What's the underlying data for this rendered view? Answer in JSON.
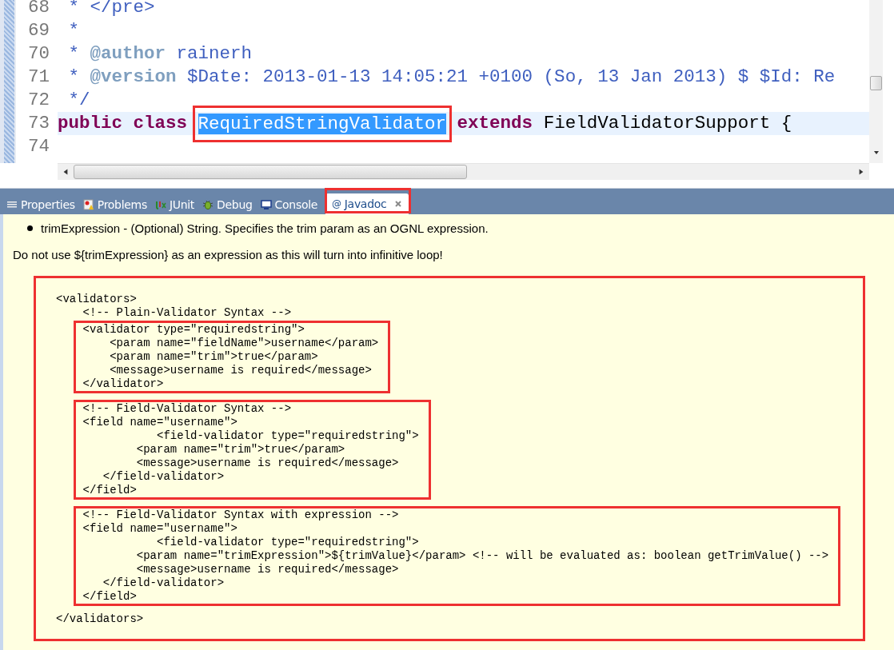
{
  "editor": {
    "lines": [
      {
        "number": "68",
        "current": false,
        "segments": [
          {
            "kind": "doc",
            "text": " * </pre>"
          }
        ]
      },
      {
        "number": "69",
        "current": false,
        "segments": [
          {
            "kind": "doc",
            "text": " *"
          }
        ]
      },
      {
        "number": "70",
        "current": false,
        "segments": [
          {
            "kind": "doc",
            "text": " * "
          },
          {
            "kind": "doctag",
            "text": "@author"
          },
          {
            "kind": "doc",
            "text": " rainerh"
          }
        ]
      },
      {
        "number": "71",
        "current": false,
        "segments": [
          {
            "kind": "doc",
            "text": " * "
          },
          {
            "kind": "doctag",
            "text": "@version"
          },
          {
            "kind": "doc",
            "text": " $Date: 2013-01-13 14:05:21 +0100 (So, 13 Jan 2013) $ $Id: Re"
          }
        ]
      },
      {
        "number": "72",
        "current": false,
        "segments": [
          {
            "kind": "doc",
            "text": " */"
          }
        ]
      },
      {
        "number": "73",
        "current": true,
        "segments": [
          {
            "kind": "keyword",
            "text": "public class "
          },
          {
            "kind": "selected",
            "text": "RequiredStringValidator"
          },
          {
            "kind": "keyword",
            "text": " extends"
          },
          {
            "kind": "plain",
            "text": " FieldValidatorSupport {"
          }
        ]
      },
      {
        "number": "74",
        "current": false
      }
    ]
  },
  "tabs": [
    {
      "label": "Properties",
      "kind": "list",
      "selected": false
    },
    {
      "label": "Problems",
      "kind": "problems",
      "selected": false
    },
    {
      "label": "JUnit",
      "kind": "junit",
      "selected": false
    },
    {
      "label": "Debug",
      "kind": "bug",
      "selected": false
    },
    {
      "label": "Console",
      "kind": "console",
      "selected": false
    },
    {
      "label": "Javadoc",
      "kind": "javadoc",
      "glyph": "@",
      "selected": true
    }
  ],
  "javadoc": {
    "bullets": [
      "trimExpression - (Optional) String. Specifies the trim param as an OGNL expression."
    ],
    "paragraph": "Do not use ${trimExpression} as an expression as this will turn into infinitive loop!",
    "code": [
      {
        "kind": "line",
        "text": "<validators>"
      },
      {
        "kind": "line",
        "text": "    <!-- Plain-Validator Syntax -->"
      },
      {
        "kind": "group",
        "lines": [
          "    <validator type=\"requiredstring\">",
          "        <param name=\"fieldName\">username</param>",
          "        <param name=\"trim\">true</param>",
          "        <message>username is required</message>",
          "    </validator>"
        ]
      },
      {
        "kind": "group",
        "lines": [
          "    <!-- Field-Validator Syntax -->",
          "    <field name=\"username\">",
          "               <field-validator type=\"requiredstring\">",
          "            <param name=\"trim\">true</param>",
          "            <message>username is required</message>",
          "       </field-validator>",
          "    </field>"
        ]
      },
      {
        "kind": "group",
        "lines": [
          "    <!-- Field-Validator Syntax with expression -->",
          "    <field name=\"username\">",
          "               <field-validator type=\"requiredstring\">",
          "            <param name=\"trimExpression\">${trimValue}</param> <!-- will be evaluated as: boolean getTrimValue() -->",
          "            <message>username is required</message>",
          "       </field-validator>",
          "    </field>"
        ]
      },
      {
        "kind": "line",
        "text": "</validators>"
      }
    ]
  }
}
